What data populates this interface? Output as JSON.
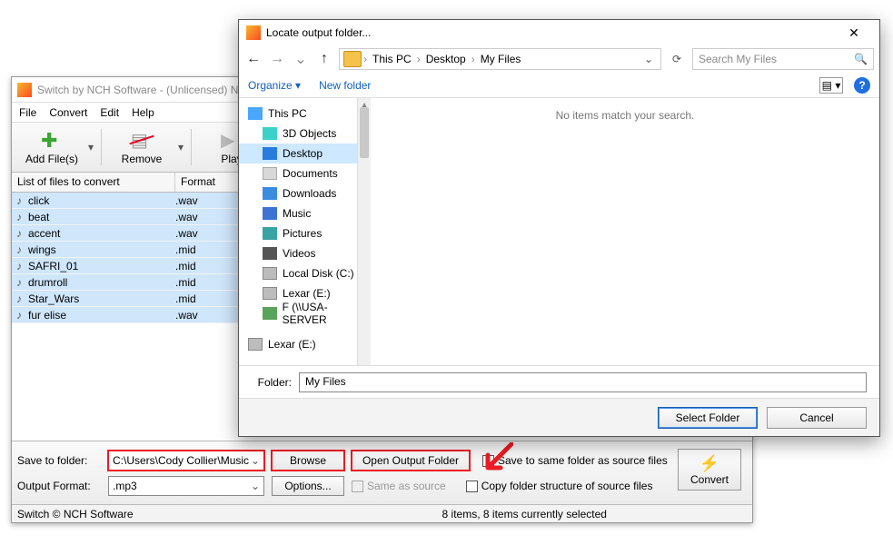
{
  "main": {
    "title": "Switch by NCH Software - (Unlicensed) No",
    "menu": {
      "file": "File",
      "convert": "Convert",
      "edit": "Edit",
      "help": "Help"
    },
    "toolbar": {
      "add": "Add File(s)",
      "remove": "Remove",
      "play": "Play"
    },
    "list": {
      "col_file": "List of files to convert",
      "col_format": "Format",
      "rows": [
        {
          "name": "click",
          "fmt": ".wav"
        },
        {
          "name": "beat",
          "fmt": ".wav"
        },
        {
          "name": "accent",
          "fmt": ".wav"
        },
        {
          "name": "wings",
          "fmt": ".mid"
        },
        {
          "name": "SAFRI_01",
          "fmt": ".mid"
        },
        {
          "name": "drumroll",
          "fmt": ".mid"
        },
        {
          "name": "Star_Wars",
          "fmt": ".mid"
        },
        {
          "name": "fur elise",
          "fmt": ".wav"
        }
      ]
    },
    "bottom": {
      "save_to_label": "Save to folder:",
      "save_to_value": "C:\\Users\\Cody Collier\\Music",
      "browse": "Browse",
      "open_output": "Open Output Folder",
      "same_folder": "Save to same folder as source files",
      "output_format_label": "Output Format:",
      "output_format_value": ".mp3",
      "options": "Options...",
      "same_as_source": "Same as source",
      "copy_struct": "Copy folder structure of source files",
      "convert": "Convert"
    },
    "status": {
      "left": "Switch © NCH Software",
      "right": "8 items, 8 items currently selected"
    }
  },
  "dlg": {
    "title": "Locate output folder...",
    "crumbs": {
      "a": "This PC",
      "b": "Desktop",
      "c": "My Files"
    },
    "search_placeholder": "Search My Files",
    "toolbar": {
      "organize": "Organize",
      "new_folder": "New folder"
    },
    "tree": {
      "this_pc": "This PC",
      "objects3d": "3D Objects",
      "desktop": "Desktop",
      "documents": "Documents",
      "downloads": "Downloads",
      "music": "Music",
      "pictures": "Pictures",
      "videos": "Videos",
      "localc": "Local Disk (C:)",
      "lexare1": "Lexar (E:)",
      "fserver": "F (\\\\USA-SERVER",
      "lexare2": "Lexar (E:)"
    },
    "empty": "No items match your search.",
    "folder_label": "Folder:",
    "folder_value": "My Files",
    "select": "Select Folder",
    "cancel": "Cancel"
  }
}
